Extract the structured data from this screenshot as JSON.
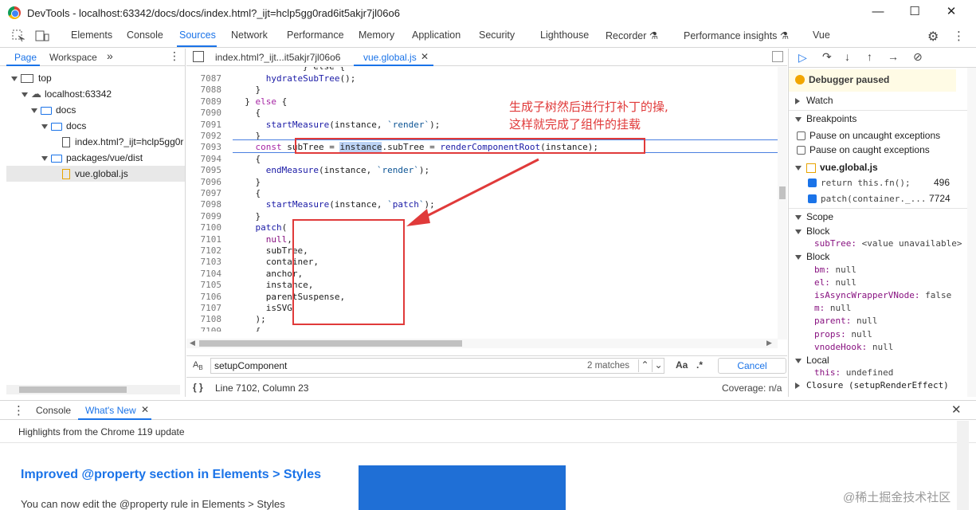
{
  "window": {
    "title": "DevTools - localhost:63342/docs/docs/index.html?_ijt=hclp5gg0rad6it5akjr7jl06o6",
    "minimize": "—",
    "maximize": "☐",
    "close": "✕"
  },
  "main_tabs": [
    "Elements",
    "Console",
    "Sources",
    "Network",
    "Performance",
    "Memory",
    "Application",
    "Security",
    "Lighthouse",
    "Recorder ⚗",
    "Performance insights ⚗",
    "Vue"
  ],
  "active_main_tab": "Sources",
  "navigator": {
    "tabs": [
      "Page",
      "Workspace"
    ],
    "more": "»",
    "tree": [
      {
        "label": "top",
        "type": "frame"
      },
      {
        "label": "localhost:63342",
        "type": "cloud"
      },
      {
        "label": "docs",
        "type": "folder"
      },
      {
        "label": "docs",
        "type": "folder"
      },
      {
        "label": "index.html?_ijt=hclp5gg0r",
        "type": "file"
      },
      {
        "label": "packages/vue/dist",
        "type": "folder"
      },
      {
        "label": "vue.global.js",
        "type": "jsfile"
      }
    ]
  },
  "editor": {
    "tabs": [
      "index.html?_ijt...it5akjr7jl06o6",
      "vue.global.js"
    ],
    "active_tab": "vue.global.js",
    "lines": [
      {
        "n": "7087",
        "code": "      hydrateSubTree();"
      },
      {
        "n": "7088",
        "code": "    }"
      },
      {
        "n": "7089",
        "code": "  } else {"
      },
      {
        "n": "7090",
        "code": "    {"
      },
      {
        "n": "7091",
        "code": "      startMeasure(instance, `render`);"
      },
      {
        "n": "7092",
        "code": "    }"
      },
      {
        "n": "7093",
        "code": "    const subTree = instance.subTree = renderComponentRoot(instance);"
      },
      {
        "n": "7094",
        "code": "    {"
      },
      {
        "n": "7095",
        "code": "      endMeasure(instance, `render`);"
      },
      {
        "n": "7096",
        "code": "    }"
      },
      {
        "n": "7097",
        "code": "    {"
      },
      {
        "n": "7098",
        "code": "      startMeasure(instance, `patch`);"
      },
      {
        "n": "7099",
        "code": "    }"
      },
      {
        "n": "7100",
        "code": "    patch("
      },
      {
        "n": "7101",
        "code": "      null,"
      },
      {
        "n": "7102",
        "code": "      subTree,"
      },
      {
        "n": "7103",
        "code": "      container,"
      },
      {
        "n": "7104",
        "code": "      anchor,"
      },
      {
        "n": "7105",
        "code": "      instance,"
      },
      {
        "n": "7106",
        "code": "      parentSuspense,"
      },
      {
        "n": "7107",
        "code": "      isSVG"
      },
      {
        "n": "7108",
        "code": "    );"
      },
      {
        "n": "7109",
        "code": "    {"
      }
    ],
    "annotation_line1": "生成子树然后进行打补丁的操,",
    "annotation_line2": "这样就完成了组件的挂载",
    "search": {
      "value": "setupComponent",
      "matches": "2 matches",
      "case_toggle": "Aa",
      "regex_toggle": ".*",
      "cancel": "Cancel"
    },
    "status": {
      "position": "Line 7102, Column 23",
      "coverage": "Coverage: n/a"
    }
  },
  "debugger": {
    "paused_label": "Debugger paused",
    "watch": "Watch",
    "breakpoints": "Breakpoints",
    "pause_uncaught": "Pause on uncaught exceptions",
    "pause_caught": "Pause on caught exceptions",
    "bp_file": "vue.global.js",
    "bp_items": [
      {
        "code": "return this.fn();",
        "line": "496"
      },
      {
        "code": "patch(container._...",
        "line": "7724"
      }
    ],
    "scope": "Scope",
    "scope_rows": [
      {
        "label": "Block",
        "kind": "header"
      },
      {
        "label": "subTree: <value unavailable>",
        "kind": "item"
      },
      {
        "label": "Block",
        "kind": "header"
      },
      {
        "label": "bm: null",
        "kind": "item"
      },
      {
        "label": "el: null",
        "kind": "item"
      },
      {
        "label": "isAsyncWrapperVNode: false",
        "kind": "item"
      },
      {
        "label": "m: null",
        "kind": "item"
      },
      {
        "label": "parent: null",
        "kind": "item"
      },
      {
        "label": "props: null",
        "kind": "item"
      },
      {
        "label": "vnodeHook: null",
        "kind": "item"
      },
      {
        "label": "Local",
        "kind": "header"
      },
      {
        "label": "this: undefined",
        "kind": "item"
      },
      {
        "label": "Closure (setupRenderEffect)",
        "kind": "collapsed"
      }
    ]
  },
  "drawer": {
    "tabs": [
      "Console",
      "What's New"
    ],
    "active_tab": "What's New",
    "subtitle": "Highlights from the Chrome 119 update",
    "heading": "Improved @property section in Elements > Styles",
    "body": "You can now edit the @property rule in Elements > Styles",
    "watermark": "@稀土掘金技术社区"
  },
  "colors": {
    "accent": "#1a73e8",
    "annotation": "#e03a3a"
  }
}
